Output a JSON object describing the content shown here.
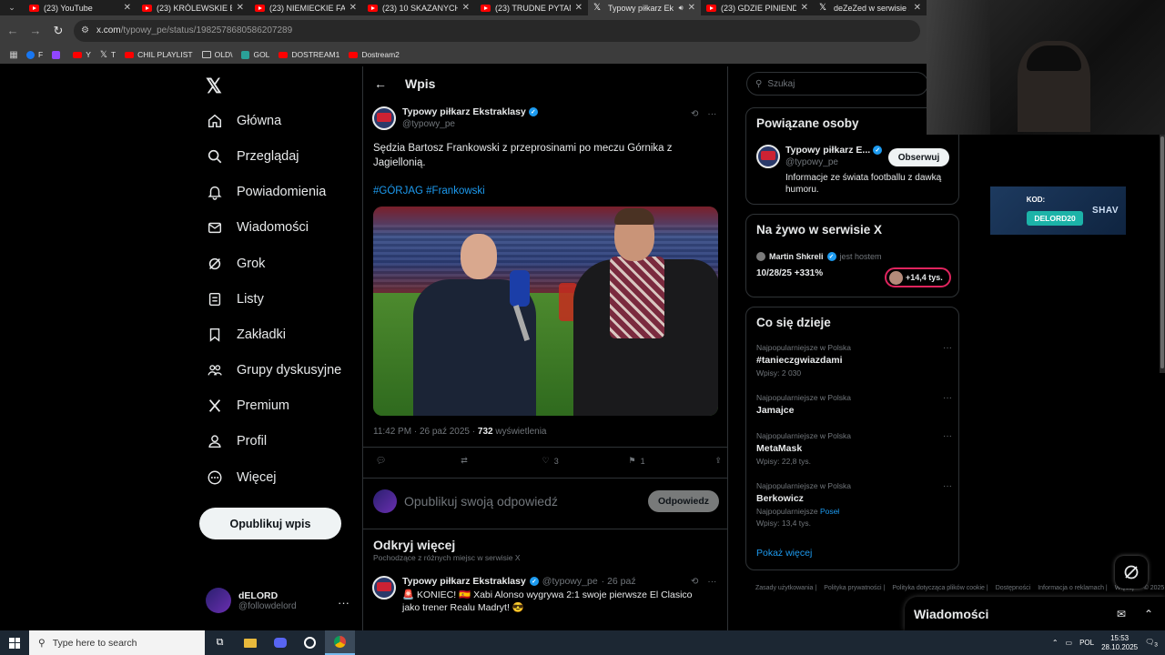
{
  "browser": {
    "tabs": [
      {
        "title": "(23) YouTube",
        "icon": "youtube-icon",
        "active": false
      },
      {
        "title": "(23) KRÓLEWSKIE EL",
        "icon": "youtube-icon",
        "active": false
      },
      {
        "title": "(23) NIEMIECKIE FABR",
        "icon": "youtube-icon",
        "active": false
      },
      {
        "title": "(23) 10 SKAZANYCH",
        "icon": "youtube-icon",
        "active": false
      },
      {
        "title": "(23) TRUDNE PYTANI",
        "icon": "youtube-icon",
        "active": false
      },
      {
        "title": "Typowy piłkarz Ek",
        "icon": "x-icon",
        "active": true
      },
      {
        "title": "(23) GDZIE PINIENDZ",
        "icon": "youtube-icon",
        "active": false
      },
      {
        "title": "deZeZed w serwisie X",
        "icon": "x-icon",
        "active": false
      }
    ],
    "url_host": "x.com",
    "url_path": "/typowy_pe/status/1982578680586207289",
    "bookmarks": [
      {
        "label": "F",
        "icon": "facebook-icon"
      },
      {
        "label": "",
        "icon": "twitch-icon"
      },
      {
        "label": "Y",
        "icon": "youtube-icon"
      },
      {
        "label": "T",
        "icon": "x-icon"
      },
      {
        "label": "CHIL PLAYLIST",
        "icon": "youtube-icon"
      },
      {
        "label": "OLD\\",
        "icon": "folder-icon"
      },
      {
        "label": "GOL",
        "icon": "gol-icon"
      },
      {
        "label": "DOSTREAM1",
        "icon": "youtube-icon"
      },
      {
        "label": "Dostream2",
        "icon": "youtube-icon"
      }
    ]
  },
  "nav": {
    "items": [
      {
        "label": "Główna",
        "icon": "home-icon"
      },
      {
        "label": "Przeglądaj",
        "icon": "search-icon"
      },
      {
        "label": "Powiadomienia",
        "icon": "bell-icon"
      },
      {
        "label": "Wiadomości",
        "icon": "mail-icon"
      },
      {
        "label": "Grok",
        "icon": "grok-icon"
      },
      {
        "label": "Listy",
        "icon": "list-icon"
      },
      {
        "label": "Zakładki",
        "icon": "bookmark-icon"
      },
      {
        "label": "Grupy dyskusyjne",
        "icon": "communities-icon"
      },
      {
        "label": "Premium",
        "icon": "x-icon"
      },
      {
        "label": "Profil",
        "icon": "user-icon"
      },
      {
        "label": "Więcej",
        "icon": "more-icon"
      }
    ],
    "post_button": "Opublikuj wpis",
    "user": {
      "name": "dELORD",
      "handle": "@followdelord"
    }
  },
  "main": {
    "title": "Wpis",
    "tweet": {
      "author": "Typowy piłkarz Ekstraklasy",
      "handle": "@typowy_pe",
      "text": "Sędzia Bartosz Frankowski z przeprosinami po meczu Górnika z Jagiellonią.",
      "hashtags": "#GÓRJAG #Frankowski",
      "time": "11:42 PM · 26 paź 2025 · ",
      "views_count": "732",
      "views_label": " wyświetlenia",
      "replies": "",
      "reposts": "",
      "likes": "3",
      "bookmarks": "1"
    },
    "reply_placeholder": "Opublikuj swoją odpowiedź",
    "reply_button": "Odpowiedz",
    "discover_title": "Odkryj więcej",
    "discover_subtitle": "Pochodzące z różnych miejsc w serwisie X",
    "tweet2": {
      "author": "Typowy piłkarz Ekstraklasy",
      "handle": "@typowy_pe",
      "date": "· 26 paź",
      "text": "🚨 KONIEC! 🇪🇸 Xabi Alonso wygrywa 2:1 swoje pierwsze El Clasico jako trener Realu Madryt! 😎"
    }
  },
  "right": {
    "search_placeholder": "Szukaj",
    "related": {
      "title": "Powiązane osoby",
      "name": "Typowy piłkarz E...",
      "handle": "@typowy_pe",
      "bio": "Informacje ze świata footballu z dawką humoru.",
      "follow_button": "Obserwuj"
    },
    "live": {
      "title": "Na żywo w serwisie X",
      "host": "Martin Shkreli",
      "host_suffix": "jest hostem",
      "headline": "10/28/25 +331%",
      "listeners": "+14,4 tys."
    },
    "trends": {
      "title": "Co się dzieje",
      "items": [
        {
          "meta": "Najpopularniejsze w Polska",
          "name": "#tanieczgwiazdami",
          "count": "Wpisy: 2 030"
        },
        {
          "meta": "Najpopularniejsze w Polska",
          "name": "Jamajce",
          "count": ""
        },
        {
          "meta": "Najpopularniejsze w Polska",
          "name": "MetaMask",
          "count": "Wpisy: 22,8 tys."
        },
        {
          "meta": "Najpopularniejsze w Polska",
          "name": "Berkowicz",
          "count": "Wpisy: 13,4 tys.",
          "extra_prefix": "Najpopularniejsze ",
          "extra_link": "Poseł"
        }
      ],
      "show_more": "Pokaż więcej"
    },
    "footer": [
      "Zasady użytkowania |",
      "Polityka prywatności |",
      "Polityka dotycząca plików cookie |",
      "Dostępności",
      "Informacja o reklamach |",
      "Więcej ··· © 2025"
    ]
  },
  "messages_drawer": {
    "title": "Wiadomości"
  },
  "sponsor": {
    "label": "KOD:",
    "code": "DELORD20",
    "brand": "SHAV"
  },
  "taskbar": {
    "search_placeholder": "Type here to search",
    "language": "POL",
    "time": "15:53",
    "date": "28.10.2025",
    "notifications": "3"
  }
}
